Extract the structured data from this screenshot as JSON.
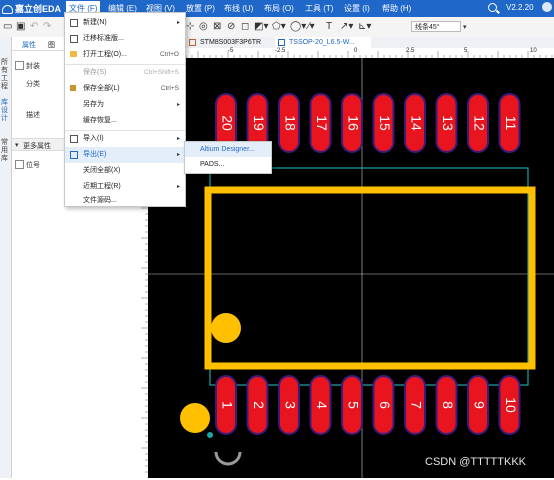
{
  "app": {
    "logo": "嘉立创EDA",
    "version": "V2.2.20"
  },
  "menubar": {
    "items": [
      "文件 (F)",
      "编辑 (E)",
      "视图 (V)",
      "放置 (P)",
      "布线 (U)",
      "布局 (O)",
      "工具 (T)",
      "设置 (I)",
      "帮助 (H)"
    ]
  },
  "toolbar": {
    "line_width": "线条45°"
  },
  "left_strip": {
    "tabs": [
      "所有工程",
      "库设计",
      "常用库"
    ]
  },
  "panel": {
    "tabs": [
      "属性",
      "图"
    ],
    "checkbox_label": "封装",
    "field1": "分类",
    "field2": "描述",
    "section": "更多属性",
    "section_item": "位号"
  },
  "doc_tabs": [
    "STM8S003F3P6TR",
    "TSSOP-20_L6.5-W..."
  ],
  "ruler_top": [
    "-5",
    "-2.5",
    "0",
    "2.5",
    "5",
    "10"
  ],
  "file_menu": {
    "items": [
      {
        "label": "新建(N)",
        "shortcut": "",
        "submenu": true,
        "disabled": false
      },
      {
        "label": "迁移标准版...",
        "shortcut": "",
        "submenu": false,
        "disabled": false
      },
      {
        "label": "打开工程(O)...",
        "shortcut": "Ctrl+O",
        "submenu": false,
        "disabled": false
      },
      {
        "label": "保存(S)",
        "shortcut": "Ctrl+Shift+S",
        "submenu": false,
        "disabled": true
      },
      {
        "label": "保存全部(L)",
        "shortcut": "Ctrl+S",
        "submenu": false,
        "disabled": false
      },
      {
        "label": "另存为",
        "shortcut": "",
        "submenu": true,
        "disabled": false
      },
      {
        "label": "缓存恢复...",
        "shortcut": "",
        "submenu": false,
        "disabled": false
      },
      {
        "label": "导入(I)",
        "shortcut": "",
        "submenu": true,
        "disabled": false
      },
      {
        "label": "导出(E)",
        "shortcut": "",
        "submenu": true,
        "disabled": false
      },
      {
        "label": "关闭全部(X)",
        "shortcut": "",
        "submenu": false,
        "disabled": false
      },
      {
        "label": "近期工程(R)",
        "shortcut": "",
        "submenu": true,
        "disabled": false
      },
      {
        "label": "文件源码...",
        "shortcut": "",
        "submenu": false,
        "disabled": false
      }
    ]
  },
  "export_submenu": {
    "items": [
      "Altium Designer...",
      "PADS..."
    ]
  },
  "footprint": {
    "top_pads": [
      "20",
      "19",
      "18",
      "17",
      "16",
      "15",
      "14",
      "13",
      "12",
      "11"
    ],
    "bottom_pads": [
      "1",
      "2",
      "3",
      "4",
      "5",
      "6",
      "7",
      "8",
      "9",
      "10"
    ],
    "colors": {
      "pad": "#e8141e",
      "pad_outline": "#3a1b7a",
      "silk": "#ffc000",
      "courtyard": "#1aa6a6",
      "canvas": "#000000"
    }
  },
  "watermark": "CSDN @TTTTTKKK"
}
